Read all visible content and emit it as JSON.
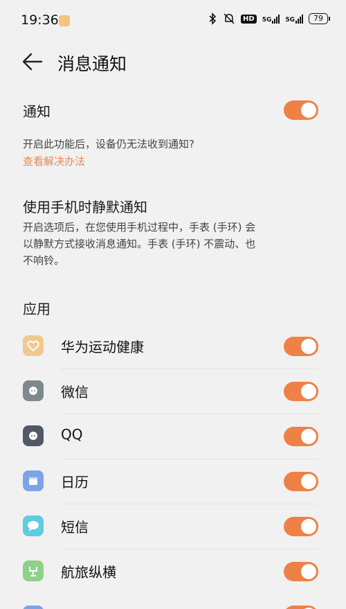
{
  "status_bar": {
    "time": "19:36",
    "hd_label": "HD",
    "five_g_1": "5G",
    "five_g_2": "5G",
    "battery": "79"
  },
  "header": {
    "title": "消息通知"
  },
  "notify": {
    "label": "通知",
    "toggle_on": true,
    "description": "开启此功能后，设备仍无法收到通知?",
    "help_link": "查看解决办法"
  },
  "silent": {
    "title": "使用手机时静默通知",
    "description_line1": "开启选项后，在您使用手机过程中，手表 (手环) 会",
    "description_line2": "以静默方式接收消息通知。手表 (手环) 不震动、也",
    "description_line3": "不响铃。"
  },
  "apps": {
    "section_title": "应用",
    "items": [
      {
        "label": "华为运动健康",
        "icon": "huawei-health-icon",
        "color": "#f0c98f",
        "on": true
      },
      {
        "label": "微信",
        "icon": "wechat-icon",
        "color": "#7d8a8c",
        "on": true
      },
      {
        "label": "QQ",
        "icon": "qq-icon",
        "color": "#525866",
        "on": true
      },
      {
        "label": "日历",
        "icon": "calendar-icon",
        "color": "#7ea3e6",
        "on": true
      },
      {
        "label": "短信",
        "icon": "sms-icon",
        "color": "#5fcce0",
        "on": true
      },
      {
        "label": "航旅纵横",
        "icon": "travel-app-icon",
        "color": "#8fd08a",
        "on": true
      }
    ]
  },
  "colors": {
    "accent": "#ee8145",
    "link": "#e58a55",
    "background": "#f1f1f1"
  }
}
